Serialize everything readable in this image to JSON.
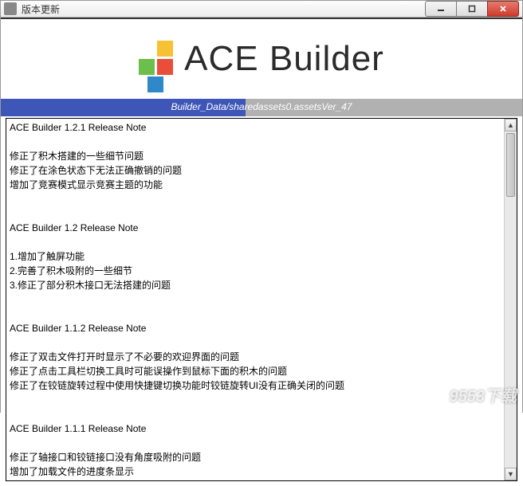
{
  "window": {
    "title": "版本更新"
  },
  "logo": {
    "text": "ACE Builder"
  },
  "progress": {
    "label": "Builder_Data/sharedassets0.assetsVer_47",
    "percent": 47
  },
  "release_notes": {
    "sections": [
      {
        "heading": "ACE Builder 1.2.1 Release Note",
        "lines": [
          "修正了积木搭建的一些细节问题",
          "修正了在涂色状态下无法正确撤销的问题",
          "增加了竞赛模式显示竞赛主题的功能"
        ]
      },
      {
        "heading": "ACE Builder 1.2 Release Note",
        "lines": [
          "1.增加了触屏功能",
          "2.完善了积木吸附的一些细节",
          "3.修正了部分积木接口无法搭建的问题"
        ]
      },
      {
        "heading": "ACE Builder 1.1.2 Release Note",
        "lines": [
          "修正了双击文件打开时显示了不必要的欢迎界面的问题",
          "修正了点击工具栏切换工具时可能误操作到鼠标下面的积木的问题",
          "修正了在铰链旋转过程中使用快捷键切换功能时铰链旋转UI没有正确关闭的问题"
        ]
      },
      {
        "heading": "ACE Builder 1.1.1 Release Note",
        "lines": [
          "修正了轴接口和铰链接口没有角度吸附的问题",
          "增加了加载文件的进度条显示"
        ]
      }
    ]
  },
  "watermark": "9553下载"
}
